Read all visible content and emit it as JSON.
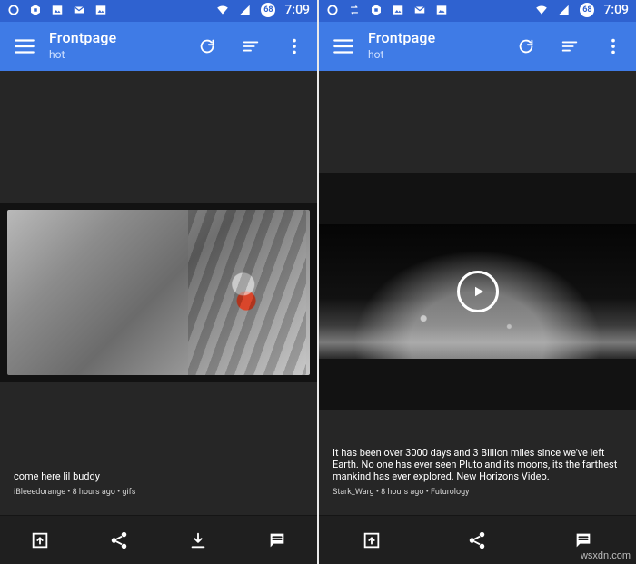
{
  "left": {
    "status": {
      "time": "7:09",
      "battery": "68"
    },
    "app": {
      "title": "Frontpage",
      "subtitle": "hot"
    },
    "post": {
      "title": "come here lil buddy",
      "meta": "iBleeedorange • 8 hours ago • gifs"
    }
  },
  "right": {
    "status": {
      "time": "7:09",
      "battery": "68"
    },
    "app": {
      "title": "Frontpage",
      "subtitle": "hot"
    },
    "post": {
      "title": "It has been over 3000 days and 3 Billion miles since we've left Earth. No one has ever seen Pluto and its moons, its the farthest mankind has ever explored. New Horizons Video.",
      "meta": "Stark_Warg • 8 hours ago • Futurology"
    }
  },
  "watermark": "wsxdn.com",
  "colors": {
    "statusbar": "#2f62d0",
    "appbar": "#3f7be6",
    "background": "#262626",
    "bottombar": "#1f1f1f"
  }
}
